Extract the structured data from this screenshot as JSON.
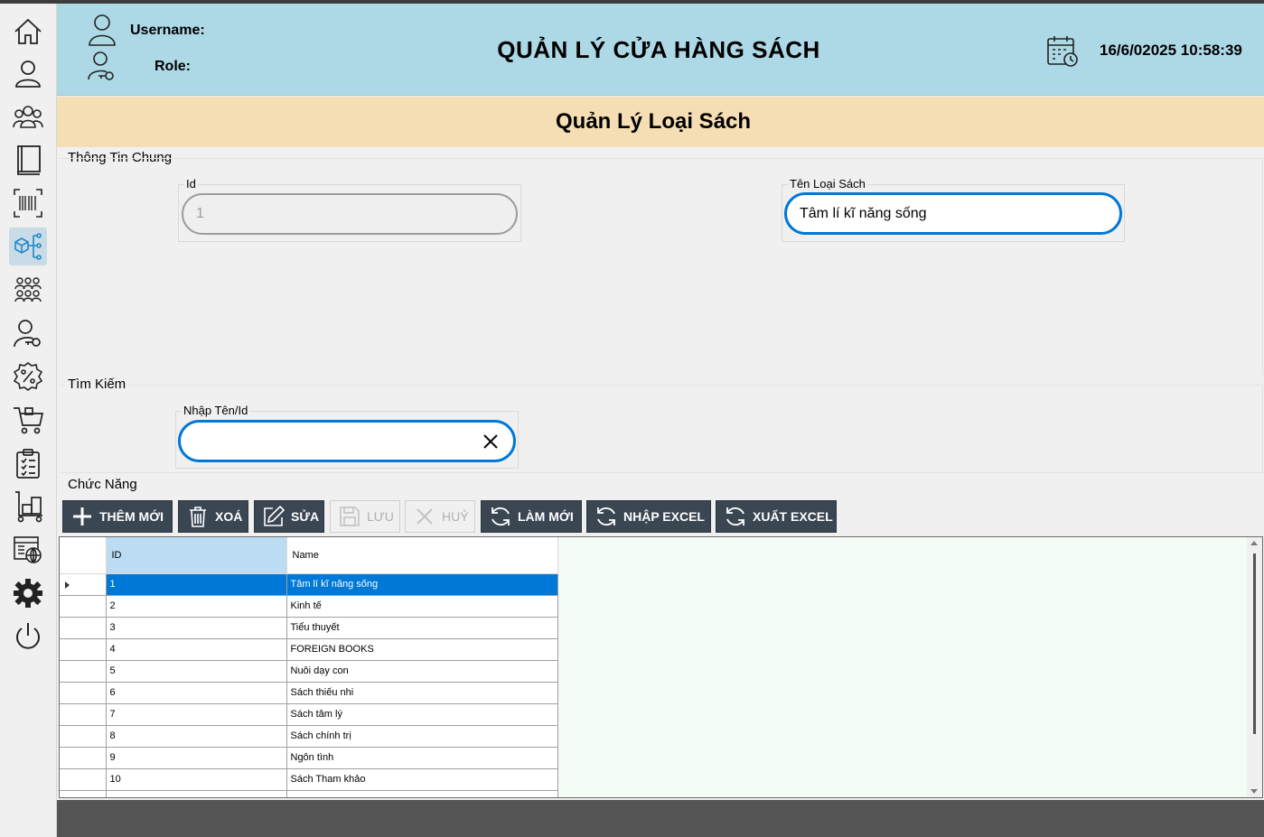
{
  "header": {
    "username_label": "Username:",
    "role_label": "Role:",
    "app_title": "QUẢN LÝ CỬA HÀNG SÁCH",
    "datetime": "16/6/02025 10:58:39"
  },
  "page": {
    "title": "Quản Lý Loại Sách"
  },
  "general_info": {
    "group_label": "Thông Tin Chung",
    "id_label": "Id",
    "id_value": "1",
    "name_label": "Tên Loại Sách",
    "name_value": "Tâm lí kĩ năng sống"
  },
  "search": {
    "group_label": "Tìm Kiếm",
    "field_label": "Nhập Tên/Id",
    "value": ""
  },
  "functions": {
    "group_label": "Chức Năng",
    "buttons": {
      "add": "THÊM MỚI",
      "delete": "XOÁ",
      "edit": "SỬA",
      "save": "LƯU",
      "cancel": "HUỶ",
      "refresh": "LÀM MỚI",
      "import": "NHẬP EXCEL",
      "export": "XUẤT EXCEL"
    }
  },
  "grid": {
    "columns": [
      "ID",
      "Name"
    ],
    "rows": [
      {
        "id": "1",
        "name": "Tâm lí kĩ năng sống"
      },
      {
        "id": "2",
        "name": "Kinh tế"
      },
      {
        "id": "3",
        "name": "Tiểu thuyết"
      },
      {
        "id": "4",
        "name": "FOREIGN BOOKS"
      },
      {
        "id": "5",
        "name": "Nuôi dạy con"
      },
      {
        "id": "6",
        "name": "Sách thiếu nhi"
      },
      {
        "id": "7",
        "name": "Sách tâm lý"
      },
      {
        "id": "8",
        "name": "Sách chính trị"
      },
      {
        "id": "9",
        "name": "Ngôn tình"
      },
      {
        "id": "10",
        "name": "Sách Tham khảo"
      }
    ]
  },
  "colors": {
    "header_bg": "#add8e6",
    "subheader_bg": "#f5deb3",
    "button_bg": "#3a4652",
    "focus_border": "#0078d7",
    "selection": "#0078d7",
    "grid_bg": "#f3fcf5"
  },
  "sidebar": {
    "icons": [
      "home-icon",
      "user-icon",
      "users-group-icon",
      "book-icon",
      "barcode-icon",
      "category-icon",
      "customers-icon",
      "user-key-icon",
      "discount-icon",
      "cart-icon",
      "clipboard-icon",
      "warehouse-icon",
      "publisher-icon",
      "settings-icon",
      "power-icon"
    ]
  }
}
